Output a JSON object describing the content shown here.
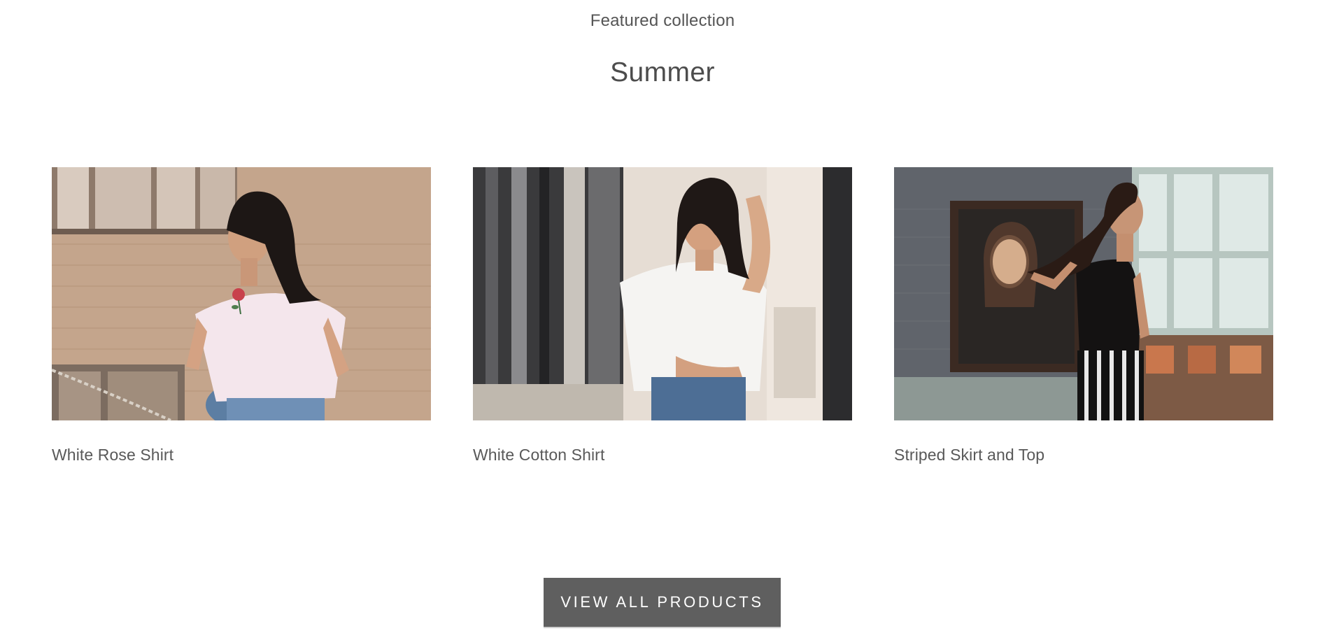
{
  "section": {
    "eyebrow": "Featured collection",
    "title": "Summer"
  },
  "products": [
    {
      "title": "White Rose Shirt",
      "image": "woman-white-rose-shirt-photo"
    },
    {
      "title": "White Cotton Shirt",
      "image": "woman-white-cotton-shirt-photo"
    },
    {
      "title": "Striped Skirt and Top",
      "image": "woman-striped-skirt-top-photo"
    }
  ],
  "cta": {
    "label": "VIEW ALL PRODUCTS"
  },
  "colors": {
    "text": "#555555",
    "button_bg": "#5f5f5f",
    "button_text": "#ffffff"
  }
}
